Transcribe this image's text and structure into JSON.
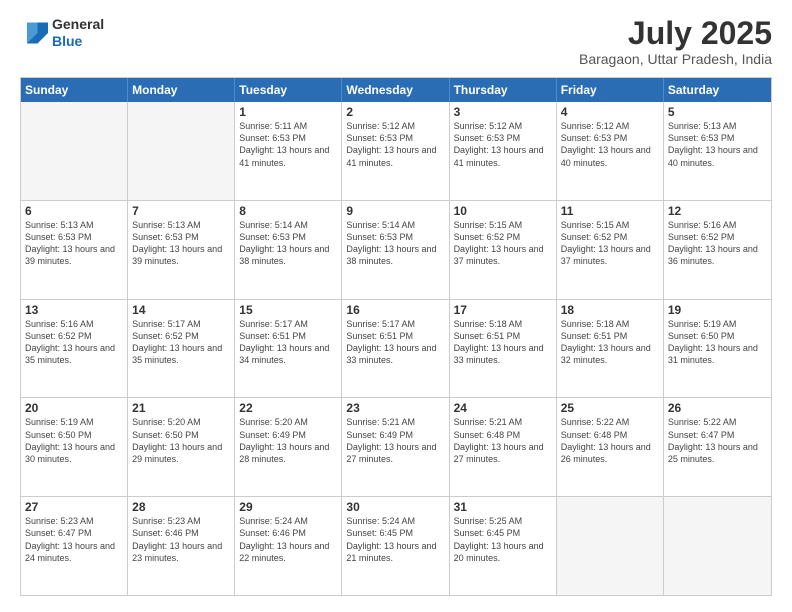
{
  "logo": {
    "line1": "General",
    "line2": "Blue"
  },
  "header": {
    "month_year": "July 2025",
    "location": "Baragaon, Uttar Pradesh, India"
  },
  "days_of_week": [
    "Sunday",
    "Monday",
    "Tuesday",
    "Wednesday",
    "Thursday",
    "Friday",
    "Saturday"
  ],
  "weeks": [
    [
      {
        "day": "",
        "info": "",
        "empty": true
      },
      {
        "day": "",
        "info": "",
        "empty": true
      },
      {
        "day": "1",
        "info": "Sunrise: 5:11 AM\nSunset: 6:53 PM\nDaylight: 13 hours and 41 minutes."
      },
      {
        "day": "2",
        "info": "Sunrise: 5:12 AM\nSunset: 6:53 PM\nDaylight: 13 hours and 41 minutes."
      },
      {
        "day": "3",
        "info": "Sunrise: 5:12 AM\nSunset: 6:53 PM\nDaylight: 13 hours and 41 minutes."
      },
      {
        "day": "4",
        "info": "Sunrise: 5:12 AM\nSunset: 6:53 PM\nDaylight: 13 hours and 40 minutes."
      },
      {
        "day": "5",
        "info": "Sunrise: 5:13 AM\nSunset: 6:53 PM\nDaylight: 13 hours and 40 minutes."
      }
    ],
    [
      {
        "day": "6",
        "info": "Sunrise: 5:13 AM\nSunset: 6:53 PM\nDaylight: 13 hours and 39 minutes."
      },
      {
        "day": "7",
        "info": "Sunrise: 5:13 AM\nSunset: 6:53 PM\nDaylight: 13 hours and 39 minutes."
      },
      {
        "day": "8",
        "info": "Sunrise: 5:14 AM\nSunset: 6:53 PM\nDaylight: 13 hours and 38 minutes."
      },
      {
        "day": "9",
        "info": "Sunrise: 5:14 AM\nSunset: 6:53 PM\nDaylight: 13 hours and 38 minutes."
      },
      {
        "day": "10",
        "info": "Sunrise: 5:15 AM\nSunset: 6:52 PM\nDaylight: 13 hours and 37 minutes."
      },
      {
        "day": "11",
        "info": "Sunrise: 5:15 AM\nSunset: 6:52 PM\nDaylight: 13 hours and 37 minutes."
      },
      {
        "day": "12",
        "info": "Sunrise: 5:16 AM\nSunset: 6:52 PM\nDaylight: 13 hours and 36 minutes."
      }
    ],
    [
      {
        "day": "13",
        "info": "Sunrise: 5:16 AM\nSunset: 6:52 PM\nDaylight: 13 hours and 35 minutes."
      },
      {
        "day": "14",
        "info": "Sunrise: 5:17 AM\nSunset: 6:52 PM\nDaylight: 13 hours and 35 minutes."
      },
      {
        "day": "15",
        "info": "Sunrise: 5:17 AM\nSunset: 6:51 PM\nDaylight: 13 hours and 34 minutes."
      },
      {
        "day": "16",
        "info": "Sunrise: 5:17 AM\nSunset: 6:51 PM\nDaylight: 13 hours and 33 minutes."
      },
      {
        "day": "17",
        "info": "Sunrise: 5:18 AM\nSunset: 6:51 PM\nDaylight: 13 hours and 33 minutes."
      },
      {
        "day": "18",
        "info": "Sunrise: 5:18 AM\nSunset: 6:51 PM\nDaylight: 13 hours and 32 minutes."
      },
      {
        "day": "19",
        "info": "Sunrise: 5:19 AM\nSunset: 6:50 PM\nDaylight: 13 hours and 31 minutes."
      }
    ],
    [
      {
        "day": "20",
        "info": "Sunrise: 5:19 AM\nSunset: 6:50 PM\nDaylight: 13 hours and 30 minutes."
      },
      {
        "day": "21",
        "info": "Sunrise: 5:20 AM\nSunset: 6:50 PM\nDaylight: 13 hours and 29 minutes."
      },
      {
        "day": "22",
        "info": "Sunrise: 5:20 AM\nSunset: 6:49 PM\nDaylight: 13 hours and 28 minutes."
      },
      {
        "day": "23",
        "info": "Sunrise: 5:21 AM\nSunset: 6:49 PM\nDaylight: 13 hours and 27 minutes."
      },
      {
        "day": "24",
        "info": "Sunrise: 5:21 AM\nSunset: 6:48 PM\nDaylight: 13 hours and 27 minutes."
      },
      {
        "day": "25",
        "info": "Sunrise: 5:22 AM\nSunset: 6:48 PM\nDaylight: 13 hours and 26 minutes."
      },
      {
        "day": "26",
        "info": "Sunrise: 5:22 AM\nSunset: 6:47 PM\nDaylight: 13 hours and 25 minutes."
      }
    ],
    [
      {
        "day": "27",
        "info": "Sunrise: 5:23 AM\nSunset: 6:47 PM\nDaylight: 13 hours and 24 minutes."
      },
      {
        "day": "28",
        "info": "Sunrise: 5:23 AM\nSunset: 6:46 PM\nDaylight: 13 hours and 23 minutes."
      },
      {
        "day": "29",
        "info": "Sunrise: 5:24 AM\nSunset: 6:46 PM\nDaylight: 13 hours and 22 minutes."
      },
      {
        "day": "30",
        "info": "Sunrise: 5:24 AM\nSunset: 6:45 PM\nDaylight: 13 hours and 21 minutes."
      },
      {
        "day": "31",
        "info": "Sunrise: 5:25 AM\nSunset: 6:45 PM\nDaylight: 13 hours and 20 minutes."
      },
      {
        "day": "",
        "info": "",
        "empty": true
      },
      {
        "day": "",
        "info": "",
        "empty": true
      }
    ]
  ]
}
